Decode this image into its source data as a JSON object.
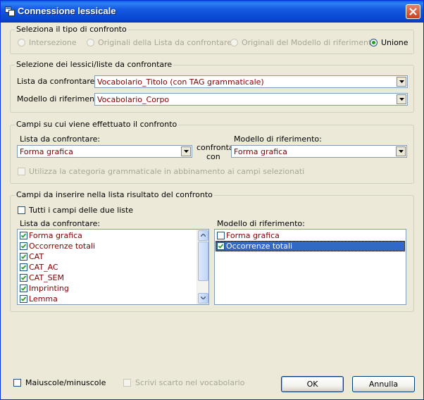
{
  "window": {
    "title": "Connessione lessicale"
  },
  "group_tipo": {
    "legend": "Seleziona il tipo di confronto",
    "options": [
      {
        "label": "Intersezione",
        "enabled": false,
        "selected": false
      },
      {
        "label": "Originali della Lista da confrontare",
        "enabled": false,
        "selected": false
      },
      {
        "label": "Originali del Modello di riferimento",
        "enabled": false,
        "selected": false
      },
      {
        "label": "Unione",
        "enabled": true,
        "selected": true
      }
    ]
  },
  "group_lessici": {
    "legend": "Selezione dei lessici/liste da confrontare",
    "lista_label": "Lista da confrontare:",
    "lista_value": "Vocabolario_Titolo (con TAG grammaticale)",
    "modello_label": "Modello di riferimento:",
    "modello_value": "Vocabolario_Corpo"
  },
  "group_campi": {
    "legend": "Campi su cui viene effettuato il confronto",
    "lista_label": "Lista da confrontare:",
    "lista_value": "Forma grafica",
    "confronta_line1": "confronta",
    "confronta_line2": "con",
    "modello_label": "Modello di riferimento:",
    "modello_value": "Forma grafica",
    "categoria_label": "Utilizza la categoria grammaticale in abbinamento ai campi selezionati"
  },
  "group_inserire": {
    "legend": "Campi da inserire nella lista risultato del confronto",
    "tutti_label": "Tutti i campi delle due liste",
    "lista_label": "Lista da confrontare:",
    "lista_items": [
      {
        "label": "Forma grafica",
        "checked": true
      },
      {
        "label": "Occorrenze totali",
        "checked": true
      },
      {
        "label": "CAT",
        "checked": true
      },
      {
        "label": "CAT_AC",
        "checked": true
      },
      {
        "label": "CAT_SEM",
        "checked": true
      },
      {
        "label": "Imprinting",
        "checked": true
      },
      {
        "label": "Lemma",
        "checked": true
      }
    ],
    "modello_label": "Modello di riferimento:",
    "modello_items": [
      {
        "label": "Forma grafica",
        "checked": false
      },
      {
        "label": "Occorrenze totali",
        "checked": true,
        "selected": true
      }
    ]
  },
  "footer": {
    "maiuscole_label": "Maiuscole/minuscole",
    "scrivi_label": "Scrivi scarto nel vocabolario",
    "ok_label": "OK",
    "annulla_label": "Annulla"
  },
  "colors": {
    "accent": "#0A5FE3",
    "value_text": "#800000",
    "selection": "#316AC5",
    "radio_dot": "#21A121"
  }
}
